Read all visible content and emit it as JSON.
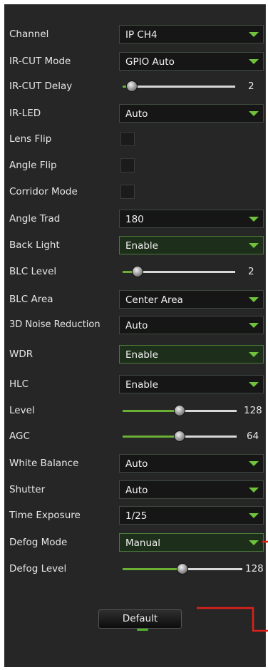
{
  "settings": {
    "channel": {
      "label": "Channel",
      "value": "IP CH4"
    },
    "ircut_mode": {
      "label": "IR-CUT Mode",
      "value": "GPIO Auto"
    },
    "ircut_delay": {
      "label": "IR-CUT Delay",
      "value": "2",
      "level": 0.08
    },
    "irled": {
      "label": "IR-LED",
      "value": "Auto"
    },
    "lens_flip": {
      "label": "Lens Flip",
      "checked": false
    },
    "angle_flip": {
      "label": "Angle Flip",
      "checked": false
    },
    "corridor_mode": {
      "label": "Corridor Mode",
      "checked": false
    },
    "angle_trad": {
      "label": "Angle Trad",
      "value": "180"
    },
    "back_light": {
      "label": "Back Light",
      "value": "Enable"
    },
    "blc_level": {
      "label": "BLC Level",
      "value": "2",
      "level": 0.13
    },
    "blc_area": {
      "label": "BLC Area",
      "value": "Center Area"
    },
    "noise_reduction": {
      "label": "3D Noise Reduction",
      "value": "Auto"
    },
    "wdr": {
      "label": "WDR",
      "value": "Enable"
    },
    "hlc": {
      "label": "HLC",
      "value": "Enable"
    },
    "level": {
      "label": "Level",
      "value": "128",
      "level": 0.5
    },
    "agc": {
      "label": "AGC",
      "value": "64",
      "level": 0.5
    },
    "white_balance": {
      "label": "White Balance",
      "value": "Auto"
    },
    "shutter": {
      "label": "Shutter",
      "value": "Auto"
    },
    "time_exposure": {
      "label": "Time Exposure",
      "value": "1/25"
    },
    "defog_mode": {
      "label": "Defog Mode",
      "value": "Manual"
    },
    "defog_level": {
      "label": "Defog Level",
      "value": "128",
      "level": 0.5
    }
  },
  "default_button": "Default",
  "colors": {
    "accent": "#6fc23a",
    "annotation": "#e0201a"
  }
}
